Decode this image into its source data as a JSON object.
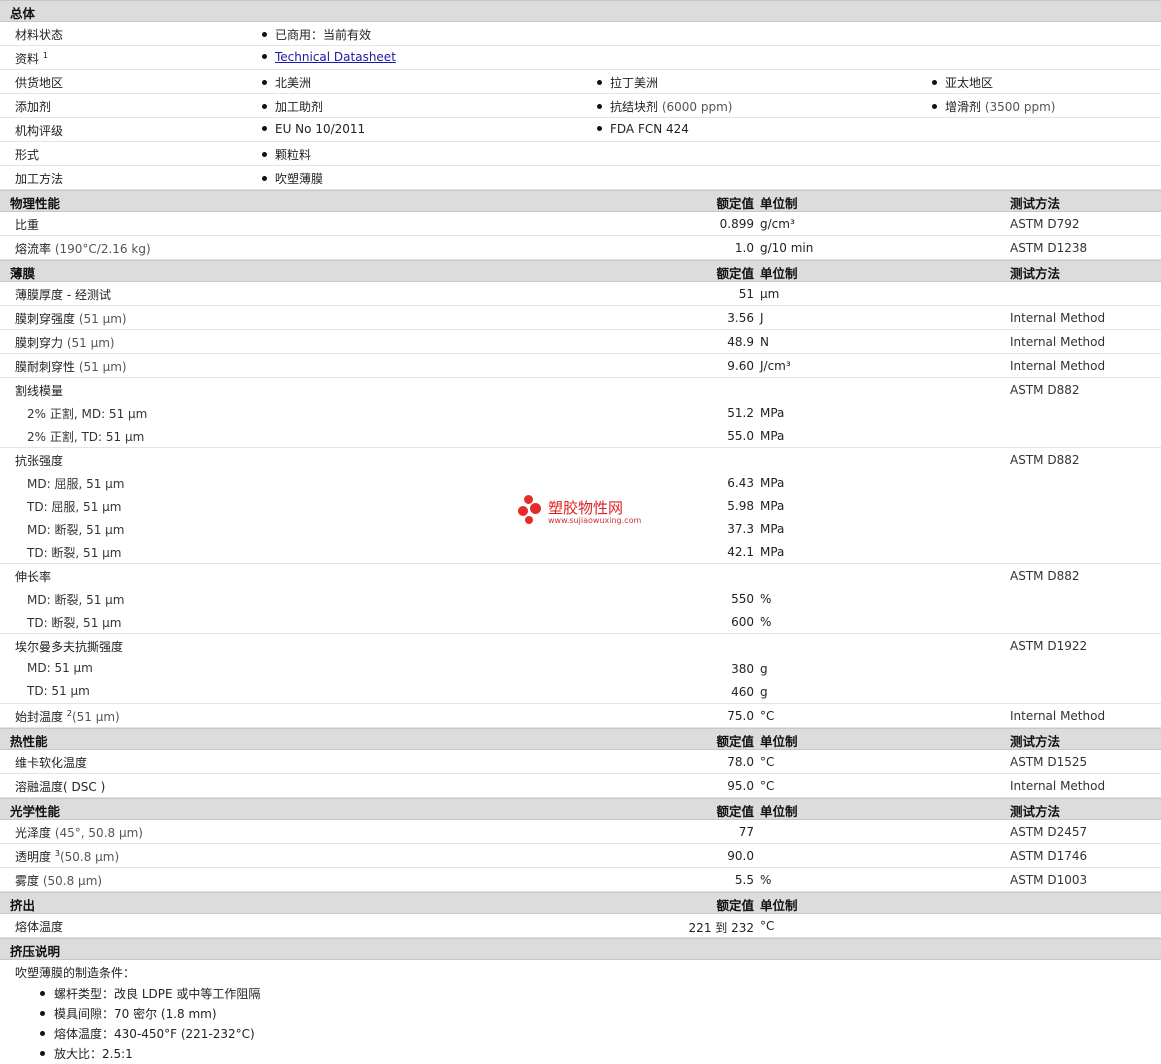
{
  "general": {
    "title": "总体",
    "status_label": "材料状态",
    "status_value": "已商用：当前有效",
    "docs_label": "资料",
    "docs_sup": "1",
    "docs_link": "Technical Datasheet",
    "supply_label": "供货地区",
    "supply": [
      "北美洲",
      "拉丁美洲",
      "亚太地区"
    ],
    "additive_label": "添加剂",
    "additives": [
      {
        "name": "加工助剂",
        "note": ""
      },
      {
        "name": "抗结块剂",
        "note": "(6000 ppm)"
      },
      {
        "name": "增滑剂",
        "note": "(3500 ppm)"
      }
    ],
    "agency_label": "机构评级",
    "agency": [
      "EU No 10/2011",
      "FDA FCN 424"
    ],
    "form_label": "形式",
    "form_value": "颗粒料",
    "process_label": "加工方法",
    "process_value": "吹塑薄膜"
  },
  "headers": {
    "value": "额定值",
    "unit": "单位制",
    "method": "测试方法"
  },
  "physical": {
    "title": "物理性能",
    "rows": [
      {
        "label": "比重",
        "cond": "",
        "value": "0.899",
        "unit": "g/cm³",
        "method": "ASTM D792"
      },
      {
        "label": "熔流率",
        "cond": "(190°C/2.16 kg)",
        "value": "1.0",
        "unit": "g/10 min",
        "method": "ASTM D1238"
      }
    ]
  },
  "film": {
    "title": "薄膜",
    "thickness": {
      "label": "薄膜厚度 - 经测试",
      "value": "51",
      "unit": "µm"
    },
    "dart": {
      "label": "膜刺穿强度",
      "cond": "(51 µm)",
      "value": "3.56",
      "unit": "J",
      "method": "Internal Method"
    },
    "puncture_force": {
      "label": "膜刺穿力",
      "cond": "(51 µm)",
      "value": "48.9",
      "unit": "N",
      "method": "Internal Method"
    },
    "puncture_res": {
      "label": "膜耐刺穿性",
      "cond": "(51 µm)",
      "value": "9.60",
      "unit": "J/cm³",
      "method": "Internal Method"
    },
    "secant": {
      "label": "割线模量",
      "method": "ASTM D882",
      "rows": [
        {
          "label": "2% 正割, MD: 51 µm",
          "value": "51.2",
          "unit": "MPa"
        },
        {
          "label": "2% 正割, TD: 51 µm",
          "value": "55.0",
          "unit": "MPa"
        }
      ]
    },
    "tensile": {
      "label": "抗张强度",
      "method": "ASTM D882",
      "rows": [
        {
          "label": "MD: 屈服, 51 µm",
          "value": "6.43",
          "unit": "MPa"
        },
        {
          "label": "TD: 屈服, 51 µm",
          "value": "5.98",
          "unit": "MPa"
        },
        {
          "label": "MD: 断裂, 51 µm",
          "value": "37.3",
          "unit": "MPa"
        },
        {
          "label": "TD: 断裂, 51 µm",
          "value": "42.1",
          "unit": "MPa"
        }
      ]
    },
    "elongation": {
      "label": "伸长率",
      "method": "ASTM D882",
      "rows": [
        {
          "label": "MD: 断裂, 51 µm",
          "value": "550",
          "unit": "%"
        },
        {
          "label": "TD: 断裂, 51 µm",
          "value": "600",
          "unit": "%"
        }
      ]
    },
    "tear": {
      "label": "埃尔曼多夫抗撕强度",
      "method": "ASTM D1922",
      "rows": [
        {
          "label": "MD: 51 µm",
          "value": "380",
          "unit": "g"
        },
        {
          "label": "TD: 51 µm",
          "value": "460",
          "unit": "g"
        }
      ]
    },
    "seal": {
      "label": "始封温度",
      "sup": "2",
      "cond": "(51 µm)",
      "value": "75.0",
      "unit": "°C",
      "method": "Internal Method"
    }
  },
  "thermal": {
    "title": "热性能",
    "rows": [
      {
        "label": "维卡软化温度",
        "cond": "",
        "value": "78.0",
        "unit": "°C",
        "method": "ASTM D1525"
      },
      {
        "label": "溶融温度",
        "cond": "( DSC )",
        "value": "95.0",
        "unit": "°C",
        "method": "Internal Method"
      }
    ]
  },
  "optical": {
    "title": "光学性能",
    "gloss": {
      "label": "光泽度",
      "cond": "(45°, 50.8 µm)",
      "value": "77",
      "unit": "",
      "method": "ASTM D2457"
    },
    "clarity": {
      "label": "透明度",
      "sup": "3",
      "cond": "(50.8 µm)",
      "value": "90.0",
      "unit": "",
      "method": "ASTM D1746"
    },
    "haze": {
      "label": "雾度",
      "cond": "(50.8 µm)",
      "value": "5.5",
      "unit": "%",
      "method": "ASTM D1003"
    }
  },
  "extrusion": {
    "title": "挤出",
    "melt": {
      "label": "熔体温度",
      "value": "221 到 232",
      "unit": "°C"
    }
  },
  "notes": {
    "title": "挤压说明",
    "intro": "吹塑薄膜的制造条件：",
    "items": [
      "螺杆类型：改良 LDPE 或中等工作阻隔",
      "模具间隙：70 密尔 (1.8 mm)",
      "熔体温度：430-450°F (221-232°C)",
      "放大比：2.5:1"
    ]
  },
  "watermark": {
    "name": "塑胶物性网",
    "url": "www.sujiaowuxing.com",
    "color": "#e52b2b"
  }
}
